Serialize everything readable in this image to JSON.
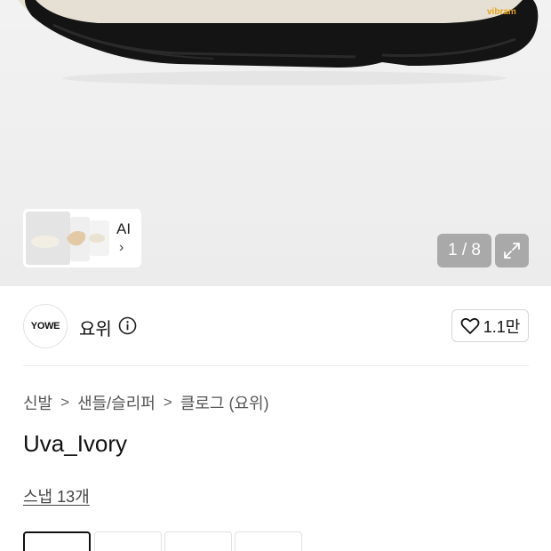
{
  "gallery": {
    "pager_text": "1 / 8",
    "ai_label": "AI",
    "ai_chevron": "›",
    "shoe_badge": "vibram",
    "accent_color": "#e8a317"
  },
  "brand": {
    "logo_text": "YOWE",
    "name": "요위"
  },
  "like": {
    "count": "1.1만"
  },
  "breadcrumb": {
    "items": [
      "신발",
      "샌들/슬리퍼",
      "클로그 (요위)"
    ],
    "separator": ">"
  },
  "product": {
    "title": "Uva_Ivory",
    "snap_link": "스냅 13개"
  },
  "options": {
    "selected_index": 0,
    "count": 4
  }
}
